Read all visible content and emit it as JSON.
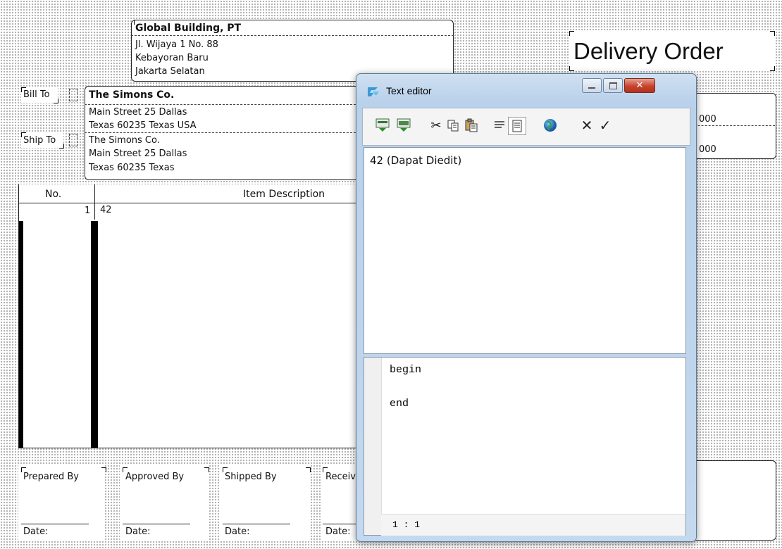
{
  "company": {
    "name": "Global Building, PT",
    "address1": "Jl. Wijaya 1 No. 88",
    "address2": "Kebayoran Baru",
    "address3": "Jakarta Selatan"
  },
  "document_title": "Delivery Order",
  "bill_to": {
    "label": "Bill To",
    "name": "The Simons Co.",
    "line1": "Main Street 25 Dallas",
    "line2": "Texas 60235 Texas USA"
  },
  "ship_to": {
    "label": "Ship To",
    "name": "The Simons Co.",
    "line1": "Main Street 25 Dallas",
    "line2": "Texas 60235  Texas"
  },
  "right_fields": {
    "value1": "000",
    "value2": "000"
  },
  "table": {
    "col_no": "No.",
    "col_desc": "Item Description",
    "row_no": "1",
    "row_desc": "42"
  },
  "signatures": [
    {
      "label": "Prepared By",
      "date": "Date:"
    },
    {
      "label": "Approved By",
      "date": "Date:"
    },
    {
      "label": "Shipped By",
      "date": "Date:"
    },
    {
      "label": "Receiv",
      "date": "Date:"
    }
  ],
  "editor": {
    "title": "Text editor",
    "content": "42   (Dapat Diedit)",
    "script_begin": "begin",
    "script_end": "end",
    "status": "1 : 1",
    "icons": [
      "insert-field-icon",
      "insert-variable-icon",
      "cut-icon",
      "copy-icon",
      "paste-icon",
      "align-icon",
      "word-wrap-icon",
      "globe-icon",
      "cancel-icon",
      "ok-icon"
    ]
  }
}
